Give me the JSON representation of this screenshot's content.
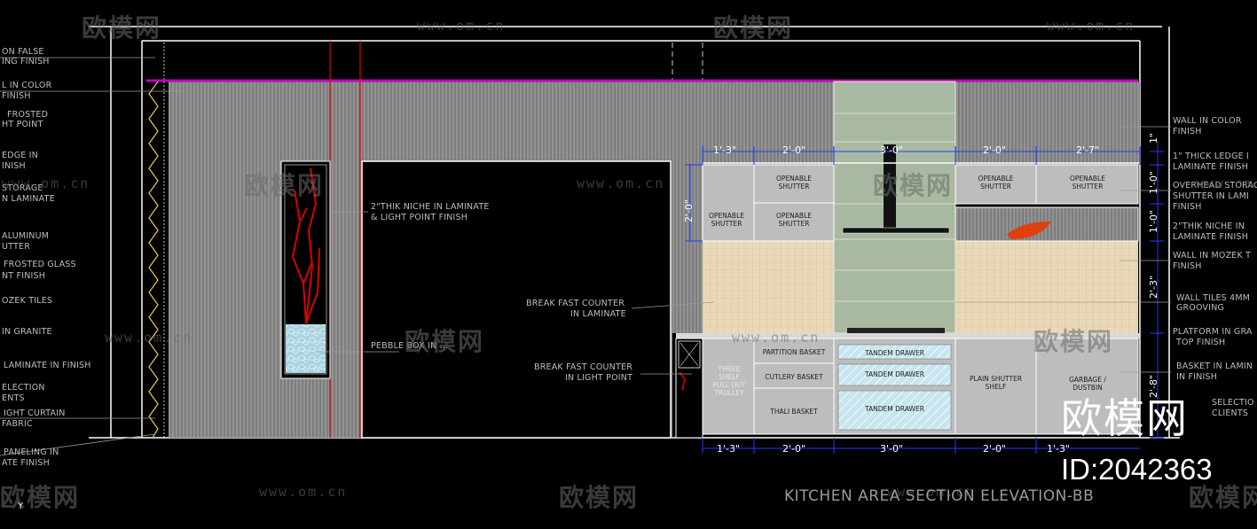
{
  "drawing": {
    "title": "KITCHEN AREA SECTION ELEVATION-BB",
    "brand_big": "欧模网",
    "brand_id": "ID:2042363",
    "ucs_label": "Y"
  },
  "watermark": {
    "url": "www.om.cn",
    "brand": "欧模网"
  },
  "left_annotations": [
    "ON FALSE",
    "ING FINISH",
    "L IN COLOR",
    "FINISH",
    "FROSTED",
    "HT POINT",
    "EDGE IN",
    "INISH",
    "STORAGE",
    "N LAMINATE",
    "ALUMINUM",
    "UTTER",
    "FROSTED GLASS",
    "NT FINISH",
    "OZEK TILES",
    "IN GRANITE",
    "LAMINATE IN FINISH",
    "ELECTION",
    "ENTS",
    "IGHT CURTAIN",
    "FABRIC",
    "PANELING IN",
    "ATE FINISH"
  ],
  "mid_annotations": {
    "niche_1": "2\"THIK NICHE IN LAMINATE",
    "niche_2": "& LIGHT POINT FINISH",
    "pebble": "PEBBLE BOX IN ...",
    "bf_laminate_1": "BREAK FAST COUNTER",
    "bf_laminate_2": "IN LAMINATE",
    "bf_light_1": "BREAK FAST COUNTER",
    "bf_light_2": "IN LIGHT POINT"
  },
  "right_annotations": [
    "WALL IN COLOR",
    "FINISH",
    "1\" THICK LEDGE I",
    "LAMINATE FINISH",
    "OVERHEAD STORAG",
    "SHUTTER IN LAMI",
    "FINISH",
    "2\"THIK NICHE IN",
    "LAMINATE FINISH",
    "WALL IN MOZEK T",
    "FINISH",
    "WALL TILES 4MM",
    "GROOVING",
    "PLATFORM IN GRA",
    "TOP FINISH",
    "BASKET IN LAMIN",
    "IN FINISH",
    "SELECTIO",
    "CLIENTS"
  ],
  "cabinet_labels": {
    "op_shutter_1": "OPENABLE\nSHUTTER",
    "op_shutter_2": "OPENABLE\nSHUTTER",
    "op_shutter_3": "OPENABLE\nSHUTTER",
    "op_shutter_4": "OPENABLE\nSHUTTER",
    "op_shutter_5": "OPENABLE\nSHUTTER",
    "partition_basket": "PARTITION BASKET",
    "cutlery_basket": "CUTLERY BASKET",
    "thali_basket": "THALI BASKET",
    "tandem_1": "TANDEM DRAWER",
    "tandem_2": "TANDEM DRAWER",
    "tandem_3": "TANDEM DRAWER",
    "plain_shutter": "PLAIN SHUTTER\nSHELF",
    "garbage": "GARBAGE /\nDUSTBIN",
    "trolley": "THREE\nSHELF\nPULL OUT\nTROLLEY"
  },
  "dimensions": {
    "top_1": "1'-3\"",
    "top_2": "2'-0\"",
    "top_3": "3'-0\"",
    "top_4": "2'-0\"",
    "top_5": "2'-7\"",
    "left_v": "2'-0\"",
    "bot_1": "1'-3\"",
    "bot_2": "2'-0\"",
    "bot_3": "3'-0\"",
    "bot_4": "2'-0\"",
    "bot_5": "1'-3\"",
    "r_v1": "1\"",
    "r_v2": "1'-0\"",
    "r_v3": "1'-0\"",
    "r_v4": "2'-3\"",
    "r_v5": "2'-8\""
  },
  "colors": {
    "background": "#000000",
    "magenta_ledge": "#c000c0",
    "red_line": "#e00000",
    "dim_blue": "#1f3cff",
    "wall_grey": "#8a8a8a",
    "cabinet_grey": "#bfbfbf",
    "hood_green": "#a8b8a0",
    "tile_beige": "#e8dcc0",
    "glass_blue": "#bfe3ee"
  }
}
